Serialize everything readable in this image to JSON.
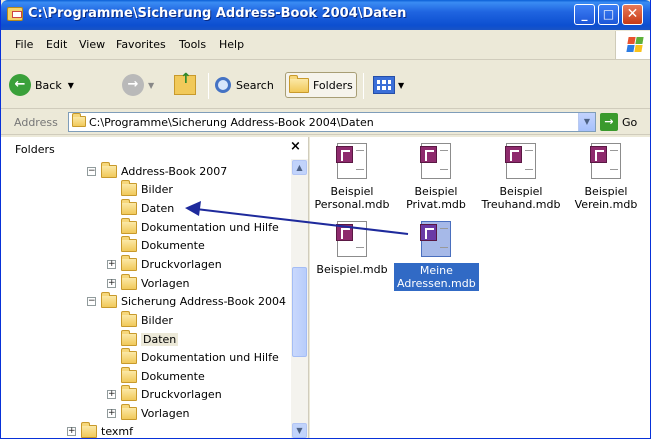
{
  "window": {
    "title": "C:\\Programme\\Sicherung Address-Book 2004\\Daten"
  },
  "menu": [
    "File",
    "Edit",
    "View",
    "Favorites",
    "Tools",
    "Help"
  ],
  "toolbar": {
    "back": "Back",
    "search": "Search",
    "folders": "Folders"
  },
  "address": {
    "label": "Address",
    "value": "C:\\Programme\\Sicherung Address-Book 2004\\Daten",
    "go": "Go"
  },
  "folders_pane": {
    "title": "Folders",
    "items": [
      {
        "label": "Address-Book 2007",
        "expander": "−"
      },
      {
        "label": "Bilder"
      },
      {
        "label": "Daten"
      },
      {
        "label": "Dokumentation und Hilfe"
      },
      {
        "label": "Dokumente"
      },
      {
        "label": "Druckvorlagen",
        "expander": "+"
      },
      {
        "label": "Vorlagen",
        "expander": "+"
      },
      {
        "label": "Sicherung Address-Book 2004",
        "expander": "−"
      },
      {
        "label": "Bilder"
      },
      {
        "label": "Daten",
        "selected": true
      },
      {
        "label": "Dokumentation und Hilfe"
      },
      {
        "label": "Dokumente"
      },
      {
        "label": "Druckvorlagen",
        "expander": "+"
      },
      {
        "label": "Vorlagen",
        "expander": "+"
      },
      {
        "label": "texmf",
        "expander": "+"
      }
    ]
  },
  "files": [
    {
      "line1": "Beispiel",
      "line2": "Personal.mdb"
    },
    {
      "line1": "Beispiel",
      "line2": "Privat.mdb"
    },
    {
      "line1": "Beispiel",
      "line2": "Treuhand.mdb"
    },
    {
      "line1": "Beispiel",
      "line2": "Verein.mdb"
    },
    {
      "line1": "Beispiel.mdb",
      "line2": ""
    },
    {
      "line1": "Meine",
      "line2": "Adressen.mdb",
      "selected": true
    }
  ],
  "colors": {
    "titlebar": "#0a5fd6",
    "selection": "#316ac5",
    "arrow": "#1e2a9c",
    "access_icon": "#8e2b6d"
  }
}
